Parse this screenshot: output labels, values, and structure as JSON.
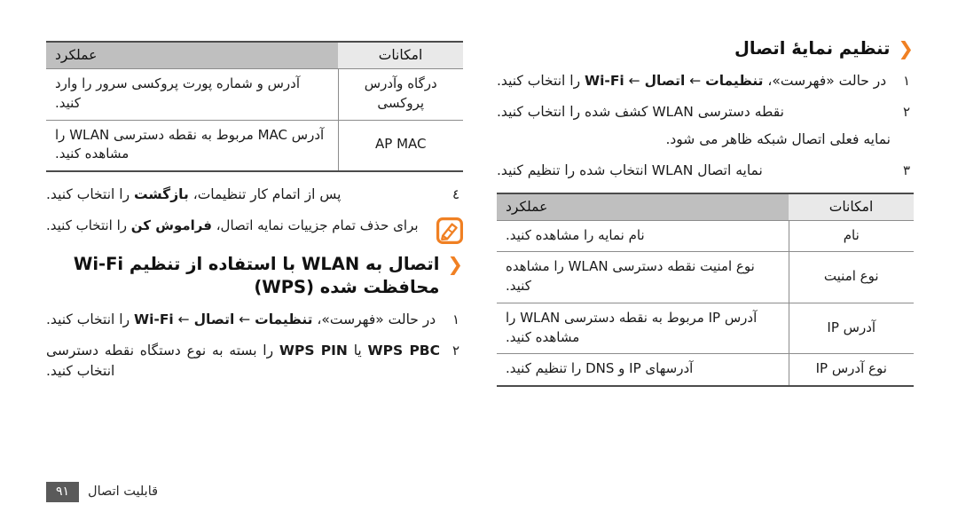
{
  "document": {
    "language": "fa",
    "accent_color": "#f08023",
    "footer": {
      "page_number": "٩١",
      "chapter_label": "قابلیت اتصال"
    }
  },
  "right_column": {
    "heading": {
      "chevron_icon": "chevron-left-icon",
      "text": "تنظیم نمایهٔ اتصال"
    },
    "steps": [
      {
        "number": "١",
        "html": "در حالت «فهرست»، <b>تنظیمات</b> ← <b>اتصال</b> ← <b>Wi-Fi</b> را انتخاب کنید."
      },
      {
        "number": "٢",
        "html": "نقطه دسترسی WLAN کشف شده را انتخاب کنید."
      }
    ],
    "sub_line": "نمایه فعلی اتصال شبکه ظاهر می شود.",
    "step3": {
      "number": "٣",
      "html": "نمایه اتصال WLAN انتخاب شده را تنظیم کنید."
    },
    "table": {
      "headers": {
        "feature": "امکانات",
        "function": "عملکرد"
      },
      "rows": [
        {
          "feature": "نام",
          "function": "نام نمایه را مشاهده کنید."
        },
        {
          "feature": "نوع امنیت",
          "function": "نوع امنیت نقطه دسترسی WLAN را مشاهده کنید."
        },
        {
          "feature": "آدرس IP",
          "function": "آدرس IP مربوط به نقطه دسترسی WLAN را مشاهده کنید."
        },
        {
          "feature": "نوع آدرس IP",
          "function": "آدرسهای IP و DNS را تنظیم کنید."
        }
      ]
    }
  },
  "left_column": {
    "table": {
      "headers": {
        "feature": "امکانات",
        "function": "عملکرد"
      },
      "rows": [
        {
          "feature": "درگاه وآدرس پروکسی",
          "function": "آدرس و شماره پورت پروکسی سرور را وارد کنید."
        },
        {
          "feature": "AP MAC",
          "function": "آدرس MAC مربوط به نقطه دسترسی WLAN را مشاهده کنید."
        }
      ]
    },
    "step4": {
      "number": "٤",
      "html": "پس از اتمام کار تنظیمات، <b>بازگشت</b> را انتخاب کنید."
    },
    "note": {
      "icon": "note-pencil-icon",
      "html": "برای حذف تمام جزییات نمایه اتصال، <b>فراموش کن</b> را انتخاب کنید."
    },
    "heading": {
      "chevron_icon": "chevron-left-icon",
      "text": "اتصال به WLAN با استفاده از تنظیم Wi-Fi محافظت شده (WPS)"
    },
    "steps": [
      {
        "number": "١",
        "html": "در حالت «فهرست»، <b>تنظیمات</b> ← <b>اتصال</b> ← <b>Wi-Fi</b> را انتخاب کنید."
      },
      {
        "number": "٢",
        "html": "<b>WPS PBC</b> یا <b>WPS PIN</b> را بسته به نوع دستگاه نقطه دسترسی انتخاب کنید."
      }
    ]
  }
}
